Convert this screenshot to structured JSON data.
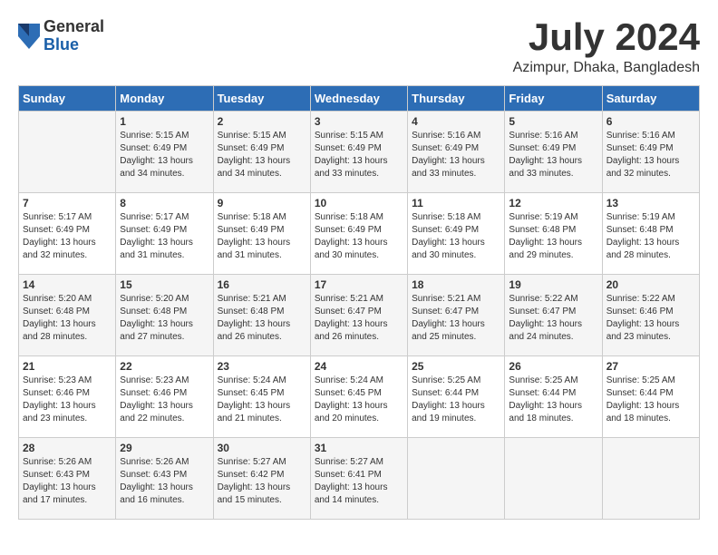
{
  "logo": {
    "general": "General",
    "blue": "Blue"
  },
  "title": "July 2024",
  "location": "Azimpur, Dhaka, Bangladesh",
  "headers": [
    "Sunday",
    "Monday",
    "Tuesday",
    "Wednesday",
    "Thursday",
    "Friday",
    "Saturday"
  ],
  "weeks": [
    [
      {
        "day": "",
        "sunrise": "",
        "sunset": "",
        "daylight": ""
      },
      {
        "day": "1",
        "sunrise": "Sunrise: 5:15 AM",
        "sunset": "Sunset: 6:49 PM",
        "daylight": "Daylight: 13 hours and 34 minutes."
      },
      {
        "day": "2",
        "sunrise": "Sunrise: 5:15 AM",
        "sunset": "Sunset: 6:49 PM",
        "daylight": "Daylight: 13 hours and 34 minutes."
      },
      {
        "day": "3",
        "sunrise": "Sunrise: 5:15 AM",
        "sunset": "Sunset: 6:49 PM",
        "daylight": "Daylight: 13 hours and 33 minutes."
      },
      {
        "day": "4",
        "sunrise": "Sunrise: 5:16 AM",
        "sunset": "Sunset: 6:49 PM",
        "daylight": "Daylight: 13 hours and 33 minutes."
      },
      {
        "day": "5",
        "sunrise": "Sunrise: 5:16 AM",
        "sunset": "Sunset: 6:49 PM",
        "daylight": "Daylight: 13 hours and 33 minutes."
      },
      {
        "day": "6",
        "sunrise": "Sunrise: 5:16 AM",
        "sunset": "Sunset: 6:49 PM",
        "daylight": "Daylight: 13 hours and 32 minutes."
      }
    ],
    [
      {
        "day": "7",
        "sunrise": "Sunrise: 5:17 AM",
        "sunset": "Sunset: 6:49 PM",
        "daylight": "Daylight: 13 hours and 32 minutes."
      },
      {
        "day": "8",
        "sunrise": "Sunrise: 5:17 AM",
        "sunset": "Sunset: 6:49 PM",
        "daylight": "Daylight: 13 hours and 31 minutes."
      },
      {
        "day": "9",
        "sunrise": "Sunrise: 5:18 AM",
        "sunset": "Sunset: 6:49 PM",
        "daylight": "Daylight: 13 hours and 31 minutes."
      },
      {
        "day": "10",
        "sunrise": "Sunrise: 5:18 AM",
        "sunset": "Sunset: 6:49 PM",
        "daylight": "Daylight: 13 hours and 30 minutes."
      },
      {
        "day": "11",
        "sunrise": "Sunrise: 5:18 AM",
        "sunset": "Sunset: 6:49 PM",
        "daylight": "Daylight: 13 hours and 30 minutes."
      },
      {
        "day": "12",
        "sunrise": "Sunrise: 5:19 AM",
        "sunset": "Sunset: 6:48 PM",
        "daylight": "Daylight: 13 hours and 29 minutes."
      },
      {
        "day": "13",
        "sunrise": "Sunrise: 5:19 AM",
        "sunset": "Sunset: 6:48 PM",
        "daylight": "Daylight: 13 hours and 28 minutes."
      }
    ],
    [
      {
        "day": "14",
        "sunrise": "Sunrise: 5:20 AM",
        "sunset": "Sunset: 6:48 PM",
        "daylight": "Daylight: 13 hours and 28 minutes."
      },
      {
        "day": "15",
        "sunrise": "Sunrise: 5:20 AM",
        "sunset": "Sunset: 6:48 PM",
        "daylight": "Daylight: 13 hours and 27 minutes."
      },
      {
        "day": "16",
        "sunrise": "Sunrise: 5:21 AM",
        "sunset": "Sunset: 6:48 PM",
        "daylight": "Daylight: 13 hours and 26 minutes."
      },
      {
        "day": "17",
        "sunrise": "Sunrise: 5:21 AM",
        "sunset": "Sunset: 6:47 PM",
        "daylight": "Daylight: 13 hours and 26 minutes."
      },
      {
        "day": "18",
        "sunrise": "Sunrise: 5:21 AM",
        "sunset": "Sunset: 6:47 PM",
        "daylight": "Daylight: 13 hours and 25 minutes."
      },
      {
        "day": "19",
        "sunrise": "Sunrise: 5:22 AM",
        "sunset": "Sunset: 6:47 PM",
        "daylight": "Daylight: 13 hours and 24 minutes."
      },
      {
        "day": "20",
        "sunrise": "Sunrise: 5:22 AM",
        "sunset": "Sunset: 6:46 PM",
        "daylight": "Daylight: 13 hours and 23 minutes."
      }
    ],
    [
      {
        "day": "21",
        "sunrise": "Sunrise: 5:23 AM",
        "sunset": "Sunset: 6:46 PM",
        "daylight": "Daylight: 13 hours and 23 minutes."
      },
      {
        "day": "22",
        "sunrise": "Sunrise: 5:23 AM",
        "sunset": "Sunset: 6:46 PM",
        "daylight": "Daylight: 13 hours and 22 minutes."
      },
      {
        "day": "23",
        "sunrise": "Sunrise: 5:24 AM",
        "sunset": "Sunset: 6:45 PM",
        "daylight": "Daylight: 13 hours and 21 minutes."
      },
      {
        "day": "24",
        "sunrise": "Sunrise: 5:24 AM",
        "sunset": "Sunset: 6:45 PM",
        "daylight": "Daylight: 13 hours and 20 minutes."
      },
      {
        "day": "25",
        "sunrise": "Sunrise: 5:25 AM",
        "sunset": "Sunset: 6:44 PM",
        "daylight": "Daylight: 13 hours and 19 minutes."
      },
      {
        "day": "26",
        "sunrise": "Sunrise: 5:25 AM",
        "sunset": "Sunset: 6:44 PM",
        "daylight": "Daylight: 13 hours and 18 minutes."
      },
      {
        "day": "27",
        "sunrise": "Sunrise: 5:25 AM",
        "sunset": "Sunset: 6:44 PM",
        "daylight": "Daylight: 13 hours and 18 minutes."
      }
    ],
    [
      {
        "day": "28",
        "sunrise": "Sunrise: 5:26 AM",
        "sunset": "Sunset: 6:43 PM",
        "daylight": "Daylight: 13 hours and 17 minutes."
      },
      {
        "day": "29",
        "sunrise": "Sunrise: 5:26 AM",
        "sunset": "Sunset: 6:43 PM",
        "daylight": "Daylight: 13 hours and 16 minutes."
      },
      {
        "day": "30",
        "sunrise": "Sunrise: 5:27 AM",
        "sunset": "Sunset: 6:42 PM",
        "daylight": "Daylight: 13 hours and 15 minutes."
      },
      {
        "day": "31",
        "sunrise": "Sunrise: 5:27 AM",
        "sunset": "Sunset: 6:41 PM",
        "daylight": "Daylight: 13 hours and 14 minutes."
      },
      {
        "day": "",
        "sunrise": "",
        "sunset": "",
        "daylight": ""
      },
      {
        "day": "",
        "sunrise": "",
        "sunset": "",
        "daylight": ""
      },
      {
        "day": "",
        "sunrise": "",
        "sunset": "",
        "daylight": ""
      }
    ]
  ]
}
